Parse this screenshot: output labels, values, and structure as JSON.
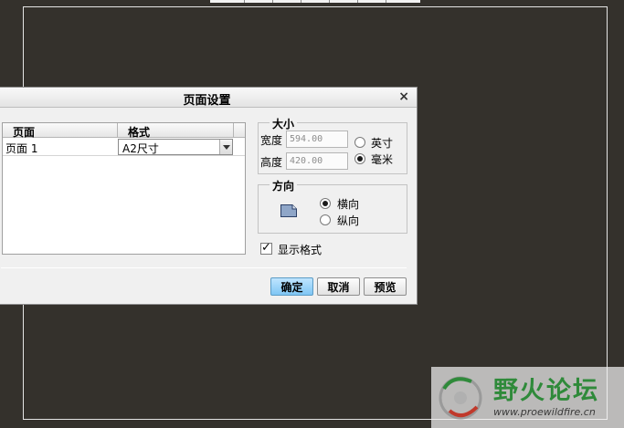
{
  "dialog": {
    "title": "页面设置",
    "close_glyph": "×"
  },
  "table": {
    "headers": [
      "页面",
      "格式"
    ],
    "rows": [
      {
        "page": "页面 1",
        "format": "A2尺寸"
      }
    ]
  },
  "size": {
    "label": "大小",
    "width_label": "宽度",
    "width_value": "594.00",
    "height_label": "高度",
    "height_value": "420.00",
    "unit_inch": "英寸",
    "unit_mm": "毫米",
    "selected_unit": "毫米"
  },
  "orientation": {
    "label": "方向",
    "landscape": "横向",
    "portrait": "纵向",
    "selected": "横向",
    "icon": "landscape-page-icon"
  },
  "show_format": {
    "label": "显示格式",
    "checked": true
  },
  "buttons": {
    "ok": "确定",
    "cancel": "取消",
    "preview": "预览"
  },
  "watermark": {
    "title": "野火论坛",
    "url": "www.proewildfire.cn"
  },
  "colors": {
    "background": "#34312c",
    "primary_button": "#7fc6f4",
    "watermark_green": "#2f8a3a"
  }
}
